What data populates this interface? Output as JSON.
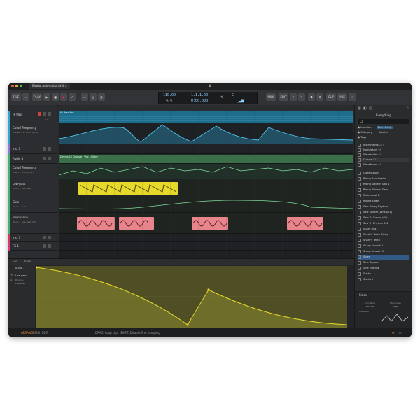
{
  "window": {
    "tab_title": "Bitwig_Automation 4.0",
    "app_icon": "grid-icon"
  },
  "toolbar": {
    "file_label": "FILE",
    "plus_label": "+",
    "play_label": "PLAY",
    "tempo": "110.00",
    "time_sig": "4/4",
    "position": "1.1.1.00",
    "time": "0:00.000",
    "key_label": "C",
    "midi_label": "MIDI",
    "edit_label": "EDIT",
    "clip_label": "CLIP",
    "mix_label": "MIX"
  },
  "tracks": [
    {
      "name": "Hi Pass",
      "sub": "0.0",
      "color": "#2ea6d6"
    },
    {
      "name": "Cutoff Frequency",
      "sub": "Hi Pass: Ext. Lfam (dt.1)",
      "color": "#2ea6d6"
    },
    {
      "name": "Inst 1",
      "sub": "",
      "color": "#8a7bd6"
    },
    {
      "name": "Audio 4",
      "sub": "",
      "color": "#41b36b"
    },
    {
      "name": "Cutoff Frequency",
      "sub": "Drum + Lfam (dt.1)",
      "color": "#41b36b"
    },
    {
      "name": "Low-pass",
      "sub": "Drum + Low-pass",
      "color": "#41b36b"
    },
    {
      "name": "Gain",
      "sub": "Drum + Gain",
      "color": "#41b36b"
    },
    {
      "name": "Resonance",
      "sub": "Drum + Low-pass (dt)",
      "color": "#41b36b"
    },
    {
      "name": "Inst 3",
      "sub": "",
      "color": "#d63a5a"
    },
    {
      "name": "FX 1",
      "sub": "",
      "color": "#d63a7a"
    }
  ],
  "clips": {
    "hi_pass_clip": "Hi Pass.flac",
    "drum_clip": "Drums 12 Groove - Vox 100am"
  },
  "detail": {
    "tab_file": "File",
    "tab_track": "Track",
    "param_label": "Low-pass",
    "param_sub": "Drum +",
    "param_sub2": "Low-pass",
    "clip_label": "Audio 1"
  },
  "browser": {
    "title": "Everything",
    "search_value": "Ca",
    "filters": [
      "Location",
      "Category",
      "Tags"
    ],
    "filter_values": [
      "Everything",
      "Creator"
    ],
    "sections": [
      {
        "name": "Instruments",
        "count": "207"
      },
      {
        "name": "Modulators",
        "count": "98"
      },
      {
        "name": "Wavetables",
        "count": "18"
      },
      {
        "name": "Curves",
        "count": "132"
      },
      {
        "name": "Waveforms",
        "count": "95"
      }
    ],
    "items": [
      "Queensbury",
      "Rising Accelerator",
      "Rising Sixteen Saw 2",
      "Rising Sixteen Saws",
      "Rollercoast B",
      "Round Edges",
      "Saw Decay Rhythm",
      "Saw Square (WPK-001)",
      "Saw Tri Turned (01)",
      "Saw Tri Rhythm 001",
      "Shark Fins",
      "Shark's Teeth Rising",
      "Shark's Teeth",
      "Sharp Smooth I",
      "Sharp Smooth II",
      "Sides",
      "Sine Square",
      "Sine Triangle",
      "Sixths I",
      "Sixths II"
    ],
    "selected_item": "Sides",
    "preview_title": "Sides",
    "preview_labels": [
      "Curvature",
      "Sharpness"
    ],
    "preview_values": [
      "Smooth",
      "Tight"
    ],
    "preview_type": "Oscillator"
  },
  "status": {
    "arrange": "ARRANGE",
    "mix": "MIX",
    "edit": "EDIT",
    "hint1": "DRAG: Loop clip",
    "hint2": "SHIFT: Disable fine snapping"
  },
  "colors": {
    "cyan": "#2ea6d6",
    "green": "#41b36b",
    "yellow": "#e6d92a",
    "pink": "#e8858c",
    "olive": "#8a8630"
  }
}
